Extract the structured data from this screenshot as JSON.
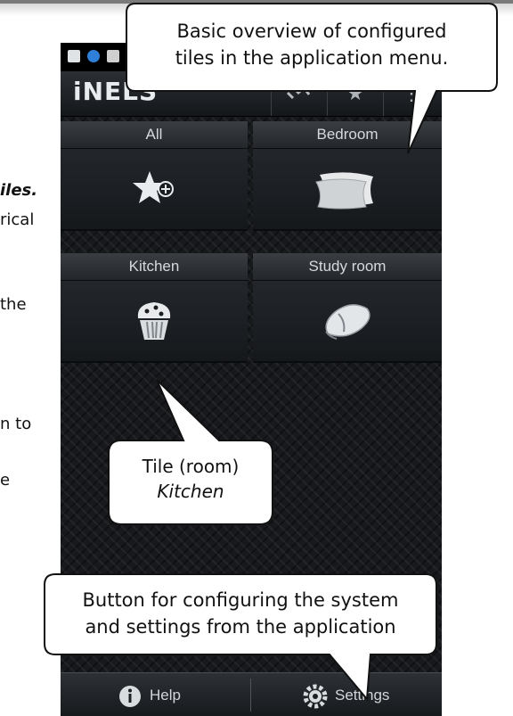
{
  "doc_fragments": {
    "line1": "iles.",
    "line2": "rical",
    "line3": "the",
    "line4": "n  to",
    "line5": "e"
  },
  "phone": {
    "logo": "iNELS",
    "tiles": [
      {
        "label": "All",
        "icon": "star-add-icon"
      },
      {
        "label": "Bedroom",
        "icon": "pillow-icon"
      },
      {
        "label": "Kitchen",
        "icon": "cupcake-icon"
      },
      {
        "label": "Study room",
        "icon": "mouse-icon"
      }
    ],
    "bottom": {
      "help_label": "Help",
      "settings_label": "Settings"
    }
  },
  "callouts": {
    "top_line1": "Basic overview of configured",
    "top_line2": "tiles in the application menu.",
    "tile_line1": "Tile (room)",
    "tile_line2": "Kitchen",
    "bottom_line1": "Button for configuring the system",
    "bottom_line2": "and settings from the application"
  },
  "colors": {
    "phone_bg": "#17191c",
    "bubble_fill": "#ffffff",
    "bubble_stroke": "#111111"
  }
}
